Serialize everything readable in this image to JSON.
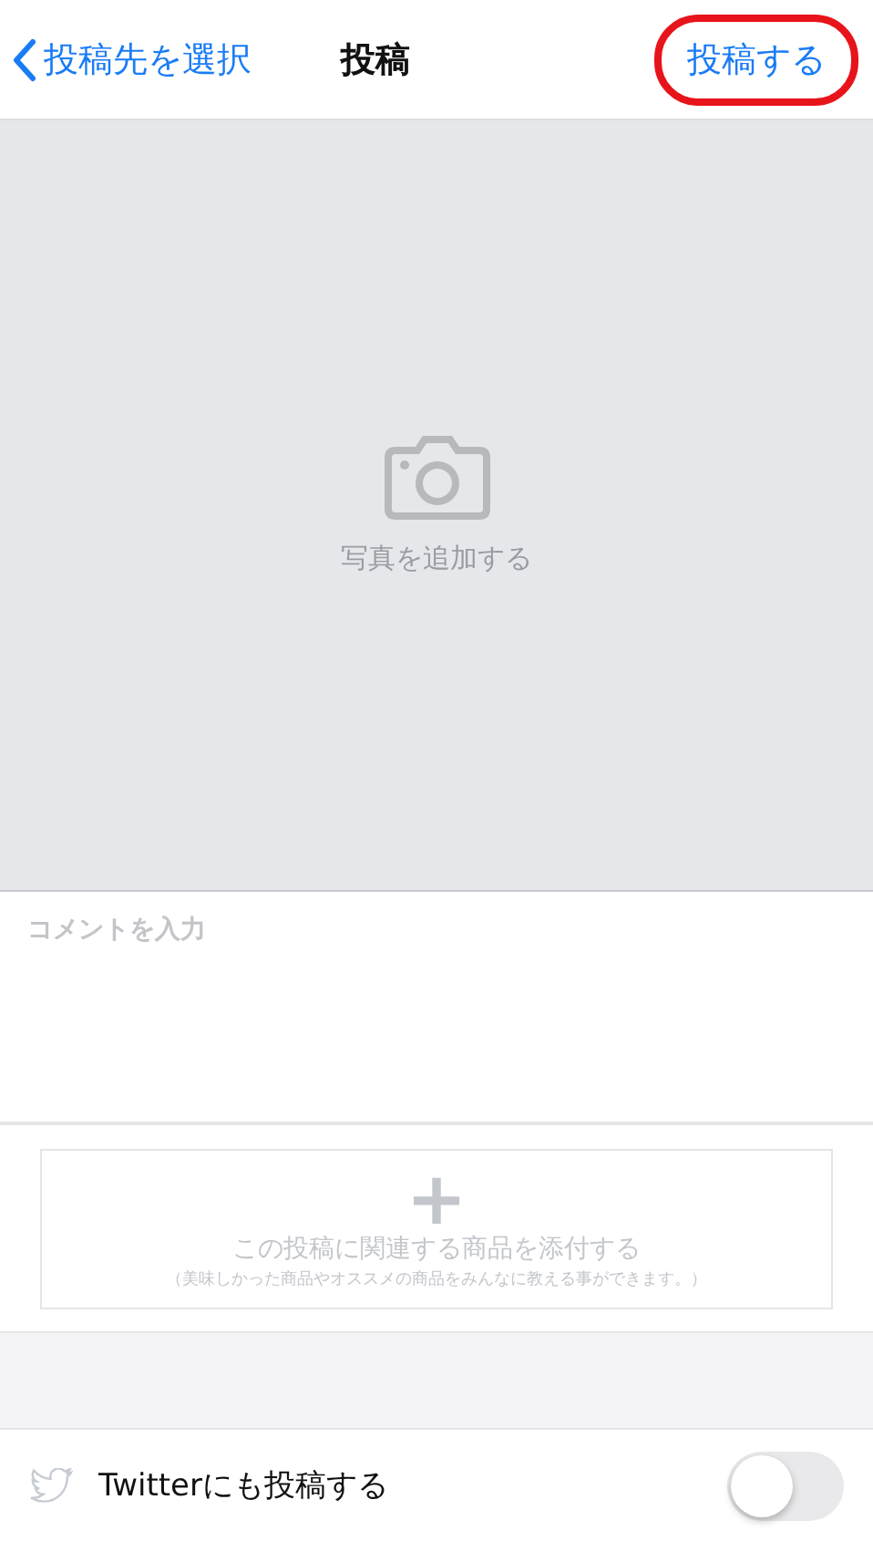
{
  "nav": {
    "back_label": "投稿先を選択",
    "title": "投稿",
    "action": "投稿する",
    "action_highlighted": true
  },
  "photo": {
    "label": "写真を追加する"
  },
  "comment": {
    "placeholder": "コメントを入力"
  },
  "attach": {
    "icon": "+",
    "label": "この投稿に関連する商品を添付する",
    "note": "（美味しかった商品やオススメの商品をみんなに教える事ができます。）"
  },
  "share": {
    "label": "Twitterにも投稿する",
    "on": false
  }
}
